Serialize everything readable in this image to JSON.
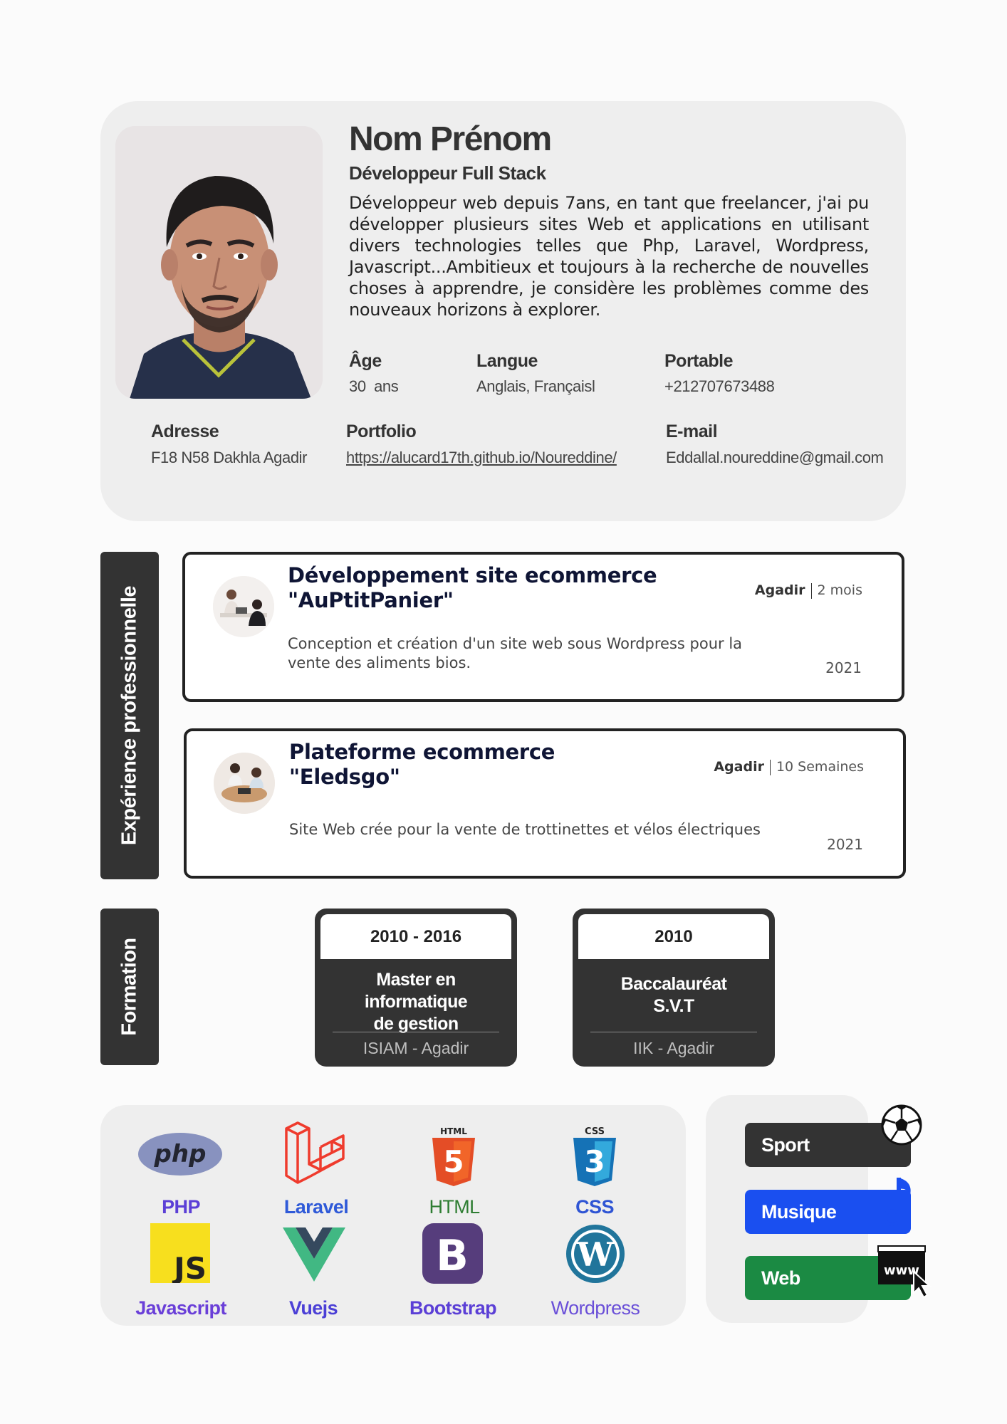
{
  "header": {
    "name": "Nom Prénom",
    "job_title": "Développeur Full Stack",
    "bio": "Développeur web depuis 7ans, en tant que freelancer, j'ai pu développer plusieurs sites Web et applications en utilisant divers technologies telles que Php, Laravel, Wordpress, Javascript...Ambitieux et toujours à la recherche de nouvelles choses à apprendre, je considère les problèmes comme des nouveaux horizons à explorer.",
    "age_label": "Âge",
    "age_value": "30  ans",
    "language_label": "Langue",
    "language_value": "Anglais, Françaisl",
    "phone_label": "Portable",
    "phone_value": "+212707673488",
    "address_label": "Adresse",
    "address_value": "F18 N58 Dakhla Agadir",
    "portfolio_label": "Portfolio",
    "portfolio_value": "https://alucard17th.github.io/Noureddine/",
    "email_label": "E-mail",
    "email_value": "Eddallal.noureddine@gmail.com"
  },
  "experience": {
    "section_label": "Expérience professionnelle",
    "items": [
      {
        "title_line1": "Développement site ecommerce",
        "title_line2": "\"AuPtitPanier\"",
        "location": "Agadir",
        "duration": "2 mois",
        "description": "Conception et création d'un site web sous Wordpress pour la vente des aliments bios.",
        "year": "2021"
      },
      {
        "title_line1": "Plateforme ecommerce",
        "title_line2": "\"Eledsgo\"",
        "location": "Agadir",
        "duration": "10 Semaines",
        "description": "Site Web crée pour la vente de trottinettes et vélos électriques",
        "year": "2021"
      }
    ]
  },
  "formation": {
    "section_label": "Formation",
    "items": [
      {
        "years": "2010 - 2016",
        "degree_line1": "Master en",
        "degree_line2": "informatique",
        "degree_line3": "de gestion",
        "school": "ISIAM - Agadir"
      },
      {
        "years": "2010",
        "degree_line1": "Baccalauréat",
        "degree_line2": "S.V.T",
        "school": "IIK - Agadir"
      }
    ]
  },
  "skills": [
    {
      "name": "PHP",
      "color": "#5b3fd6",
      "icon": "php-logo-icon"
    },
    {
      "name": "Laravel",
      "color": "#2f5ad8",
      "icon": "laravel-logo-icon"
    },
    {
      "name": "HTML",
      "color": "#2e7d32",
      "icon": "html5-logo-icon"
    },
    {
      "name": "CSS",
      "color": "#2f55d4",
      "icon": "css3-logo-icon"
    },
    {
      "name": "Javascript",
      "color": "#6a3fd8",
      "icon": "javascript-logo-icon"
    },
    {
      "name": "Vuejs",
      "color": "#4b3fd6",
      "icon": "vuejs-logo-icon"
    },
    {
      "name": "Bootstrap",
      "color": "#5b3fd6",
      "icon": "bootstrap-logo-icon"
    },
    {
      "name": "Wordpress",
      "color": "#6a4fd8",
      "icon": "wordpress-logo-icon"
    }
  ],
  "hobbies": [
    {
      "name": "Sport",
      "color": "#333333",
      "icon": "soccer-ball-icon"
    },
    {
      "name": "Musique",
      "color": "#1a4ff0",
      "icon": "music-note-icon"
    },
    {
      "name": "Web",
      "color": "#1b8a43",
      "icon": "www-cursor-icon"
    }
  ]
}
